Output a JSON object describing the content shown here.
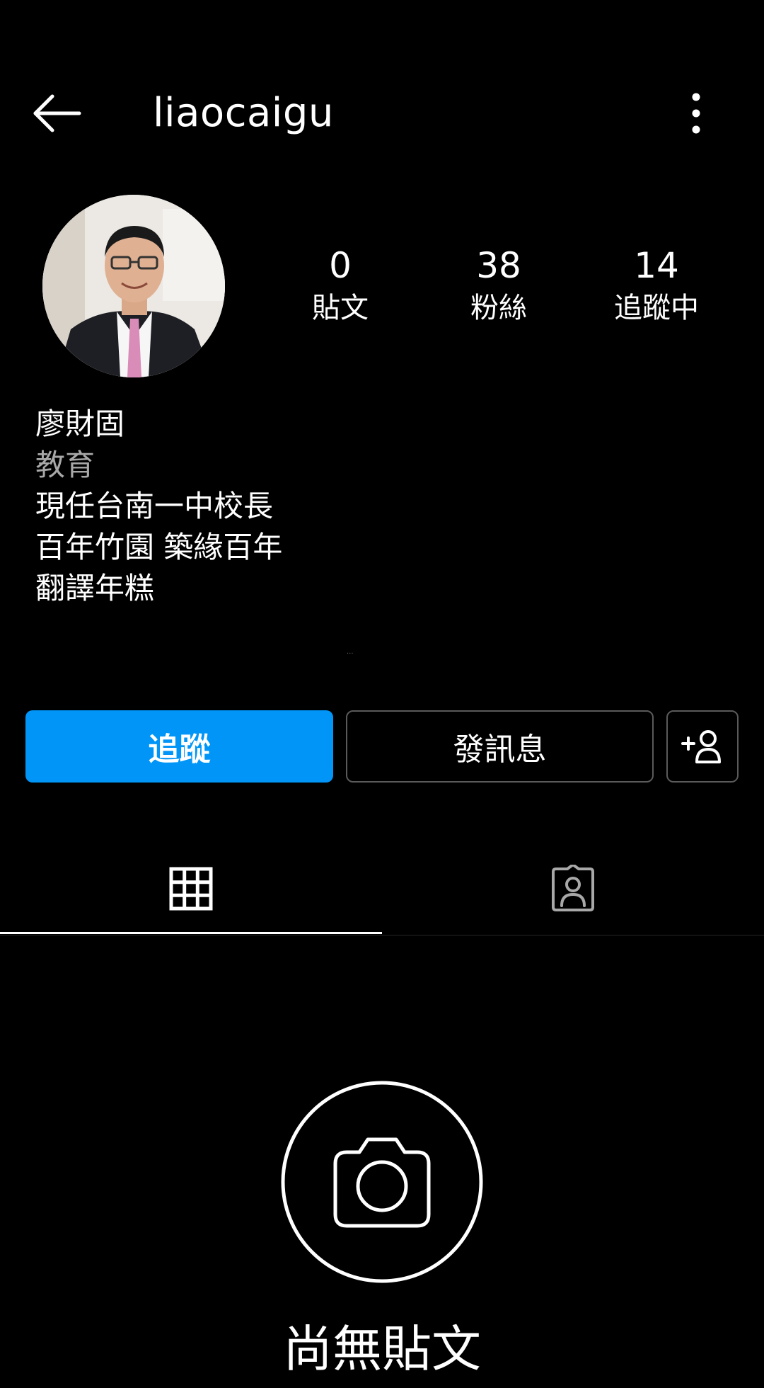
{
  "header": {
    "back_icon": "arrow-left-icon",
    "username": "liaocaigu",
    "more_icon": "more-vertical-icon"
  },
  "profile": {
    "avatar_icon": "profile-photo"
  },
  "stats": [
    {
      "value": "0",
      "label": "貼文"
    },
    {
      "value": "38",
      "label": "粉絲"
    },
    {
      "value": "14",
      "label": "追蹤中"
    }
  ],
  "bio": {
    "name": "廖財固",
    "category": "教育",
    "lines": [
      "現任台南一中校長",
      "百年竹園 築緣百年",
      "翻譯年糕"
    ]
  },
  "actions": {
    "follow_label": "追蹤",
    "message_label": "發訊息",
    "suggest_icon": "add-person-icon"
  },
  "tabs": {
    "grid_icon": "grid-icon",
    "tagged_icon": "tagged-person-icon",
    "active": "grid"
  },
  "empty_state": {
    "icon": "camera-icon",
    "text": "尚無貼文"
  },
  "colors": {
    "background": "#000000",
    "text": "#ffffff",
    "secondary_text": "#a8a8a8",
    "follow_button": "#0095f6",
    "button_border": "#5a5a5a"
  }
}
